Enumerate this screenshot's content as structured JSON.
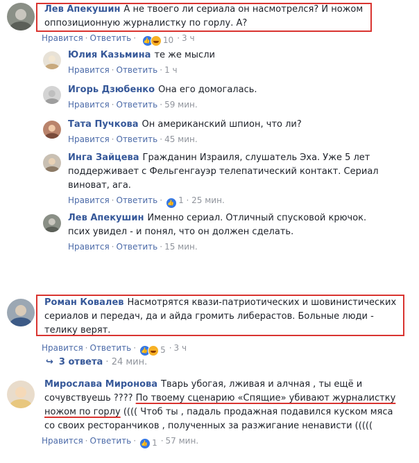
{
  "colors": {
    "link": "#365899",
    "meta": "#90949c",
    "highlight": "#d93430",
    "like": "#3578e5",
    "haha": "#f7b125"
  },
  "comments": [
    {
      "author": "Лев Апекушин",
      "text": "А не твоего ли сериала он насмотрелся? И ножом оппозиционную журналистку по горлу. А?",
      "like_label": "Нравится",
      "reply_label": "Ответить",
      "reactions": "10",
      "time": "3 ч"
    },
    {
      "author": "Юлия Казьмина",
      "text": "те же мысли",
      "like_label": "Нравится",
      "reply_label": "Ответить",
      "time": "1 ч"
    },
    {
      "author": "Игорь Дзюбенко",
      "text": "Она его домогалась.",
      "like_label": "Нравится",
      "reply_label": "Ответить",
      "time": "59 мин."
    },
    {
      "author": "Тата Пучкова",
      "text": "Он американский шпион, что ли?",
      "like_label": "Нравится",
      "reply_label": "Ответить",
      "time": "45 мин."
    },
    {
      "author": "Инга Зайцева",
      "text": "Гражданин Израиля, слушатель Эха. Уже 5 лет поддерживает с Фельгенгауэр телепатический контакт. Сериал виноват, ага.",
      "like_label": "Нравится",
      "reply_label": "Ответить",
      "reactions": "1",
      "time": "1 · 25 мин."
    },
    {
      "author": "Лев Апекушин",
      "text": "Именно сериал. Отличный спусковой крючок. псих увидел - и понял, что он должен сделать.",
      "like_label": "Нравится",
      "reply_label": "Ответить",
      "time": "15 мин."
    },
    {
      "author": "Роман Ковалев",
      "text": "Насмотрятся квази-патриотических и шовинистических сериалов и передач, да и айда громить либерастов. Больные люди - телику верят.",
      "like_label": "Нравится",
      "reply_label": "Ответить",
      "reactions": "5",
      "time": "3 ч"
    },
    {
      "author": "Мирослава Миронова",
      "text_plain": "Тварь убогая, лживая и алчная , ты ещё и сочувствуешь ????",
      "text_underlined": "По твоему сценарию «Спящие» убивают журналистку ножом по горлу",
      "text_after": "(((( Чтоб ты , падаль продажная подавился куском мяса со своих ресторанчиков , полученных за разжигание ненависти (((((",
      "like_label": "Нравится",
      "reply_label": "Ответить",
      "reactions": "1",
      "time": "57 мин."
    }
  ],
  "replies_toggle": {
    "label": "3 ответа",
    "time": "24 мин."
  }
}
